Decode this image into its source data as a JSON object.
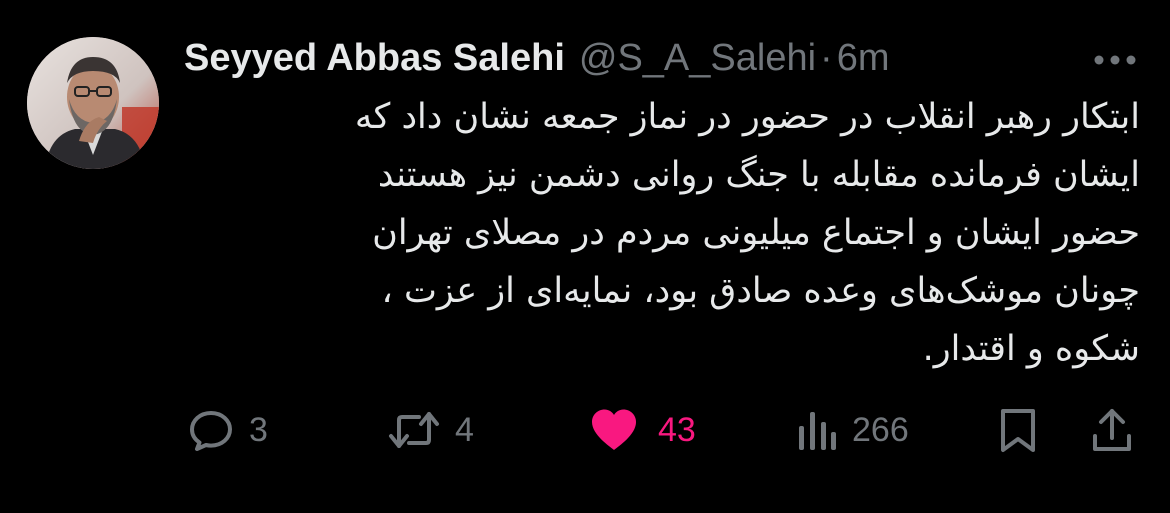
{
  "author": {
    "display_name": "Seyyed Abbas Salehi",
    "handle": "@S_A_Salehi",
    "separator": "·",
    "time": "6m"
  },
  "tweet": {
    "lines": [
      "ابتکار رهبر انقلاب در حضور در نماز جمعه نشان داد که",
      "ایشان فرمانده مقابله با جنگ روانی دشمن نیز هستند",
      "حضور ایشان و اجتماع میلیونی مردم در مصلای تهران",
      "چونان موشک‌های وعده صادق بود، نمایه‌ای از عزت ،",
      "شکوه و اقتدار."
    ]
  },
  "actions": {
    "replies": "3",
    "reposts": "4",
    "likes": "43",
    "views": "266"
  },
  "icons": {
    "more": "more-horizontal-icon",
    "reply": "reply-icon",
    "repost": "repost-icon",
    "like": "heart-icon",
    "views": "views-chart-icon",
    "bookmark": "bookmark-icon",
    "share": "share-icon"
  },
  "colors": {
    "background": "#000000",
    "text": "#e7e9ea",
    "secondary": "#71767b",
    "like": "#f91880"
  }
}
